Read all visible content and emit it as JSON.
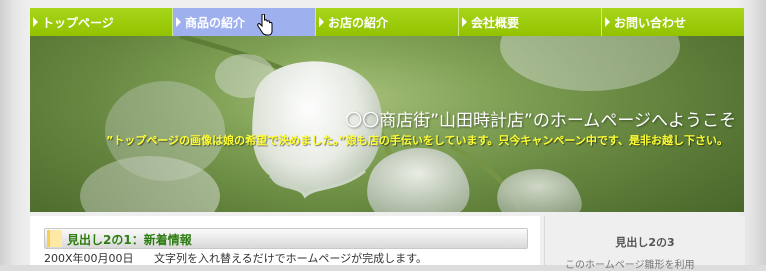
{
  "nav": {
    "items": [
      {
        "label": "トップページ"
      },
      {
        "label": "商品の紹介"
      },
      {
        "label": "お店の紹介"
      },
      {
        "label": "会社概要"
      },
      {
        "label": "お問い合わせ"
      }
    ],
    "active_index": 1,
    "arrow_icon": "triangle-right-icon"
  },
  "hero": {
    "title": "〇〇商店街”山田時計店”のホームページへようこそ",
    "subtitle": "”トップページの画像は娘の希望で決めました。”娘も店の手伝いをしています。只今キャンペーン中です、是非お越し下さい。"
  },
  "main": {
    "heading": "見出し2の1：新着情報",
    "news": [
      {
        "date": "200X年00月00日",
        "text": "文字列を入れ替えるだけでホームページが完成します。"
      }
    ]
  },
  "side": {
    "heading": "見出し2の3",
    "text": "このホームページ雛形を利用"
  },
  "colors": {
    "nav_bg": "#9ccc00",
    "nav_active": "#9fb0ee",
    "heading_text": "#2e7d12",
    "hero_subtitle": "#ffff33"
  }
}
